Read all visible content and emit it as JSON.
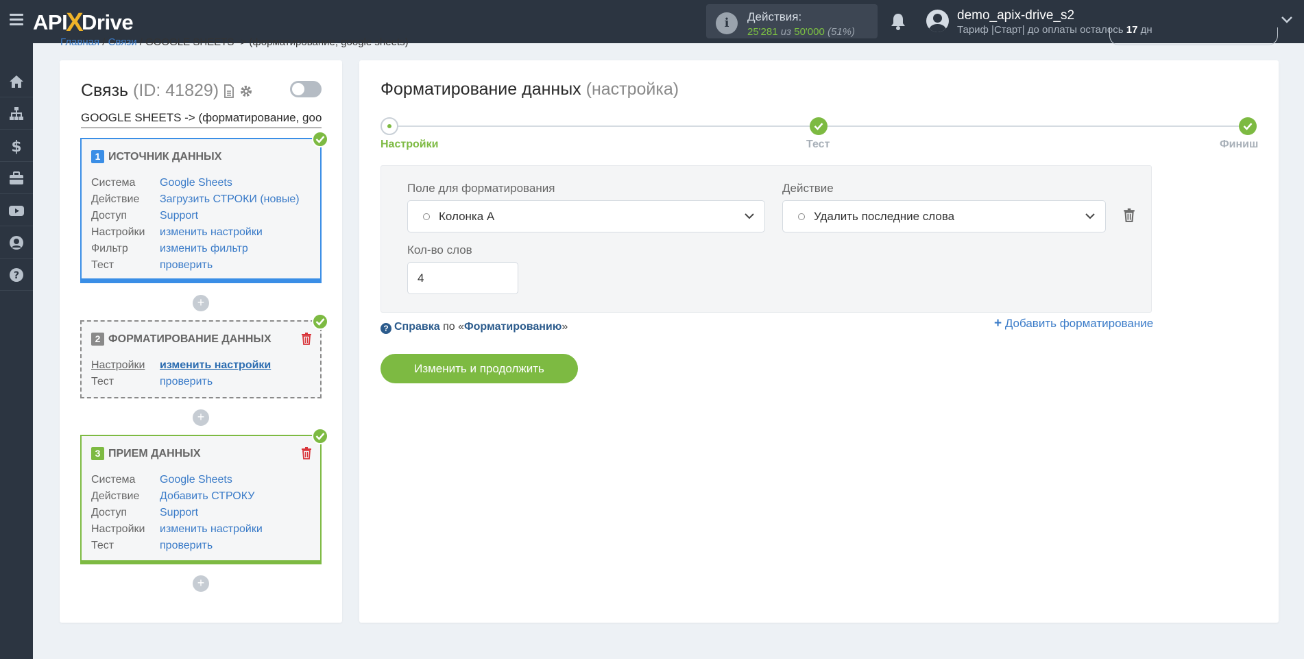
{
  "header": {
    "logo_api": "API",
    "logo_x": "X",
    "logo_drive": "Drive",
    "actions_title": "Действия:",
    "actions_used": "25'281",
    "actions_of": "из",
    "actions_total": "50'000",
    "actions_percent": "(51%)",
    "user_name": "demo_apix-drive_s2",
    "plan_text": "Тариф |Старт| до оплаты осталось",
    "plan_days": "17",
    "plan_days_unit": "дн"
  },
  "breadcrumb": {
    "home": "Главная",
    "links": "Связи",
    "current": "GOOGLE SHEETS -> (форматирование, google sheets)"
  },
  "connection": {
    "title": "Связь",
    "id_label": "(ID: 41829)",
    "name": "GOOGLE SHEETS -> (форматирование, google sheets)"
  },
  "block1": {
    "num": "1",
    "title": "ИСТОЧНИК ДАННЫХ",
    "rows": [
      {
        "k": "Система",
        "v": "Google Sheets"
      },
      {
        "k": "Действие",
        "v": "Загрузить СТРОКИ (новые)"
      },
      {
        "k": "Доступ",
        "v": "Support"
      },
      {
        "k": "Настройки",
        "v": "изменить настройки"
      },
      {
        "k": "Фильтр",
        "v": "изменить фильтр"
      },
      {
        "k": "Тест",
        "v": "проверить"
      }
    ]
  },
  "block2": {
    "num": "2",
    "title": "ФОРМАТИРОВАНИЕ ДАННЫХ",
    "rows": [
      {
        "k": "Настройки",
        "v": "изменить настройки"
      },
      {
        "k": "Тест",
        "v": "проверить"
      }
    ]
  },
  "block3": {
    "num": "3",
    "title": "ПРИЕМ ДАННЫХ",
    "rows": [
      {
        "k": "Система",
        "v": "Google Sheets"
      },
      {
        "k": "Действие",
        "v": "Добавить СТРОКУ"
      },
      {
        "k": "Доступ",
        "v": "Support"
      },
      {
        "k": "Настройки",
        "v": "изменить настройки"
      },
      {
        "k": "Тест",
        "v": "проверить"
      }
    ]
  },
  "plus_label": "+",
  "main": {
    "title": "Форматирование данных",
    "subtitle": "(настройка)",
    "steps": [
      "Настройки",
      "Тест",
      "Финиш"
    ],
    "field_label": "Поле для форматирования",
    "field_value": "Колонка A",
    "action_label": "Действие",
    "action_value": "Удалить последние слова",
    "count_label": "Кол-во слов",
    "count_value": "4",
    "help_q": "?",
    "help_prefix": "Справка",
    "help_mid": "по «",
    "help_link": "Форматированию",
    "help_suffix": "»",
    "add_plus": "+",
    "add_label": "Добавить форматирование",
    "submit_label": "Изменить и продолжить"
  },
  "colors": {
    "accent_green": "#7dba42",
    "accent_blue": "#3a8ee6",
    "topbar": "#2c3541"
  }
}
